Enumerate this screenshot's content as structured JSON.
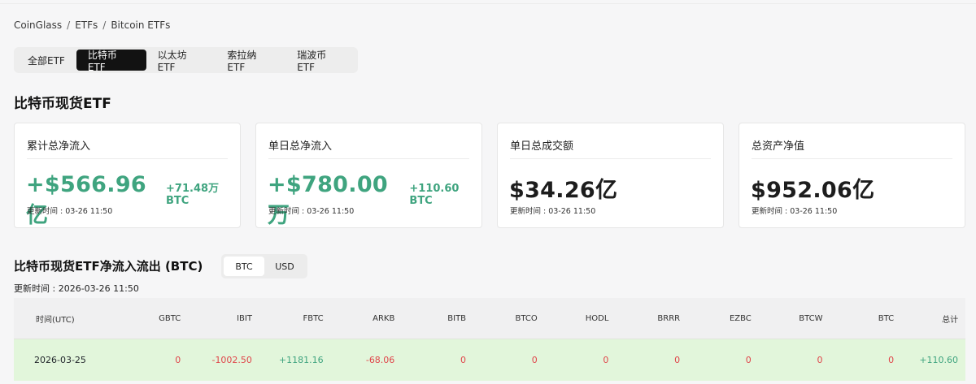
{
  "breadcrumb": [
    "CoinGlass",
    "ETFs",
    "Bitcoin ETFs"
  ],
  "breadcrumb_sep": "/",
  "tabs": [
    {
      "label": "全部ETF",
      "active": false
    },
    {
      "label": "比特币ETF",
      "active": true
    },
    {
      "label": "以太坊ETF",
      "active": false
    },
    {
      "label": "索拉纳ETF",
      "active": false
    },
    {
      "label": "瑞波币ETF",
      "active": false
    }
  ],
  "section_title": "比特币现货ETF",
  "cards": [
    {
      "label": "累计总净流入",
      "value": "+$566.96亿",
      "sub": "+71.48万 BTC",
      "time": "更新时间 : 03-26 11:50"
    },
    {
      "label": "单日总净流入",
      "value": "+$780.00万",
      "sub": "+110.60 BTC",
      "time": "更新时间 : 03-26 11:50"
    },
    {
      "label": "单日总成交额",
      "value": "$34.26亿",
      "sub": "",
      "time": "更新时间 : 03-26 11:50"
    },
    {
      "label": "总资产净值",
      "value": "$952.06亿",
      "sub": "",
      "time": "更新时间 : 03-26 11:50"
    }
  ],
  "flow": {
    "title": "比特币现货ETF净流入流出 (BTC)",
    "toggle": {
      "btc": "BTC",
      "usd": "USD",
      "active": "BTC"
    },
    "updated": "更新时间 : 2026-03-26 11:50"
  },
  "table": {
    "headers": [
      "时间(UTC)",
      "GBTC",
      "IBIT",
      "FBTC",
      "ARKB",
      "BITB",
      "BTCO",
      "HODL",
      "BRRR",
      "EZBC",
      "BTCW",
      "BTC",
      "总计"
    ],
    "rows": [
      [
        "2026-03-25",
        "0",
        "-1002.50",
        "+1181.16",
        "-68.06",
        "0",
        "0",
        "0",
        "0",
        "0",
        "0",
        "0",
        "+110.60"
      ]
    ]
  },
  "colors": {
    "positive": "#3fa47f",
    "negative": "#e0454a",
    "row_bg": "#e2f6db",
    "active_tab": "#121212"
  }
}
